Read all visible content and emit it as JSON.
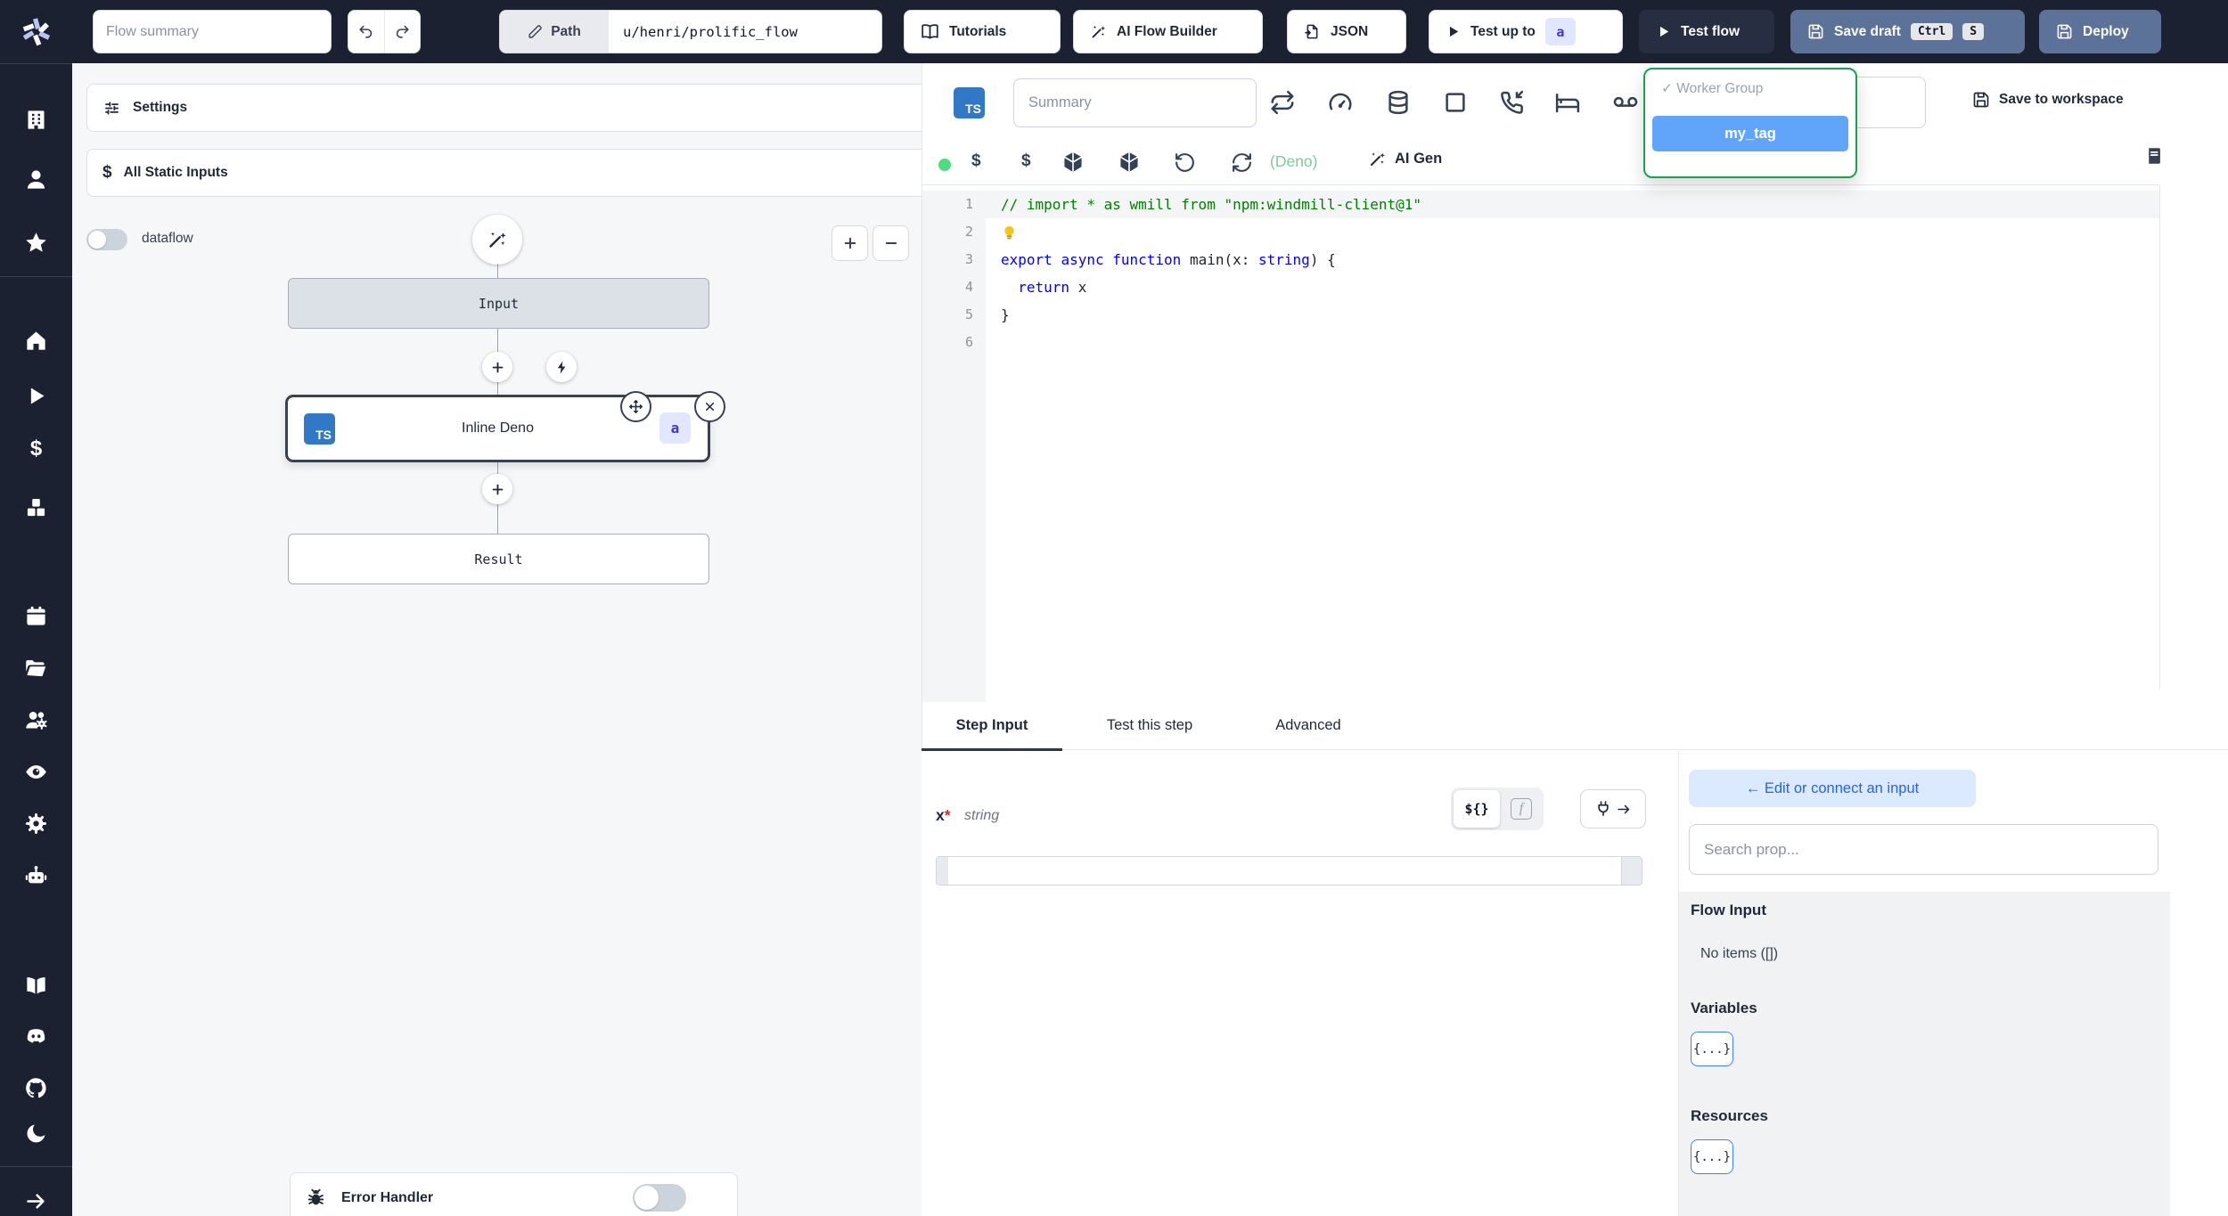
{
  "topbar": {
    "flow_summary_placeholder": "Flow summary",
    "path_label": "Path",
    "path_value": "u/henri/prolific_flow",
    "tutorials_label": "Tutorials",
    "ai_flow_builder_label": "AI Flow Builder",
    "json_label": "JSON",
    "test_up_to_label": "Test up to",
    "test_up_to_badge": "a",
    "test_flow_label": "Test flow",
    "save_draft_label": "Save draft",
    "kbd_ctrl": "Ctrl",
    "kbd_s": "S",
    "deploy_label": "Deploy"
  },
  "sidebar": {
    "icons": [
      "building",
      "user",
      "star",
      "home",
      "play",
      "dollar",
      "blocks",
      "calendar",
      "folder-open",
      "users-cog",
      "eye",
      "gear",
      "bot",
      "book-open",
      "discord",
      "github",
      "moon",
      "arrow-right"
    ]
  },
  "flow_panel": {
    "settings_label": "Settings",
    "all_static_inputs_label": "All Static Inputs",
    "dataflow_label": "dataflow",
    "input_node_label": "Input",
    "step_node_title": "Inline Deno",
    "step_lang_badge": "TS",
    "step_id_badge": "a",
    "result_node_label": "Result",
    "error_handler_label": "Error Handler"
  },
  "editor": {
    "lang_badge": "TS",
    "summary_placeholder": "Summary",
    "runtime_label": "(Deno)",
    "ai_gen_label": "AI Gen",
    "worker_group_dropdown": {
      "group_label": "✓ Worker Group",
      "selected_tag": "my_tag"
    },
    "save_to_workspace_label": "Save to workspace",
    "code": {
      "line_numbers": [
        "1",
        "2",
        "3",
        "4",
        "5",
        "6"
      ],
      "lines": [
        [
          {
            "text": "// import * as wmill from \"npm:windmill-client@1\"",
            "style": "comment"
          }
        ],
        [],
        [
          {
            "text": "export",
            "style": "keyword"
          },
          {
            "text": " ",
            "style": "plain"
          },
          {
            "text": "async",
            "style": "keyword"
          },
          {
            "text": " ",
            "style": "plain"
          },
          {
            "text": "function",
            "style": "keyword"
          },
          {
            "text": " main(x: ",
            "style": "plain"
          },
          {
            "text": "string",
            "style": "keyword"
          },
          {
            "text": ") {",
            "style": "plain"
          }
        ],
        [
          {
            "text": "  ",
            "style": "plain"
          },
          {
            "text": "return",
            "style": "keyword"
          },
          {
            "text": " x",
            "style": "plain"
          }
        ],
        [
          {
            "text": "}",
            "style": "plain"
          }
        ],
        []
      ]
    }
  },
  "tabs": {
    "step_input": "Step Input",
    "test_this_step": "Test this step",
    "advanced": "Advanced"
  },
  "step_input": {
    "field_name": "x",
    "required_mark": "*",
    "field_type": "string",
    "template_toggle_label": "${}",
    "fn_toggle_label": "f"
  },
  "right_panel": {
    "edit_connect_label": "← Edit or connect an input",
    "search_placeholder": "Search prop...",
    "flow_input_title": "Flow Input",
    "flow_input_empty": "No items ([])",
    "variables_title": "Variables",
    "variables_chip": "{...}",
    "resources_title": "Resources",
    "resources_chip": "{...}"
  },
  "colors": {
    "topbar_bg": "#1b2130",
    "primary_button": "#5d7299",
    "dark_button": "#272e41",
    "badge_indigo_bg": "#e0e7ff",
    "badge_indigo_text": "#4338ca",
    "ts_badge_blue": "#3178c6",
    "dropdown_border_green": "#16a34a",
    "tag_selected_bg": "#60a5fa",
    "status_dot_green": "#4ade80",
    "deno_green": "#82c8a0",
    "edit_connect_bg": "#dbeafe",
    "edit_connect_text": "#2563eb"
  }
}
